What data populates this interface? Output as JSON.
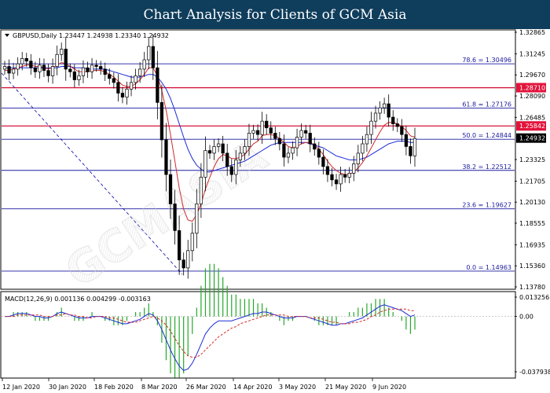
{
  "header": {
    "title": "Chart Analysis for Clients of GCM Asia"
  },
  "chart_data": {
    "type": "candlestick",
    "symbol_info": "GBPUSD,Daily  1.23447 1.24938 1.23340 1.24932",
    "y_ticks": [
      "1.32865",
      "1.31245",
      "1.29670",
      "1.28090",
      "1.26485",
      "1.24932",
      "1.23325",
      "1.21705",
      "1.20130",
      "1.18555",
      "1.16935",
      "1.15360",
      "1.13780"
    ],
    "ylim": [
      1.1378,
      1.32865
    ],
    "x_ticks": [
      "12 Jan 2020",
      "30 Jan 2020",
      "18 Feb 2020",
      "8 Mar 2020",
      "26 Mar 2020",
      "14 Apr 2020",
      "3 May 2020",
      "21 May 2020",
      "9 Jun 2020"
    ],
    "last_price": {
      "label": "1.24932",
      "value": 1.24932
    },
    "fib_levels": [
      {
        "label": "78.6 = 1.30496",
        "value": 1.30496
      },
      {
        "label": "61.8 = 1.27176",
        "value": 1.27176
      },
      {
        "label": "50.0 = 1.24844",
        "value": 1.24844
      },
      {
        "label": "38.2 = 1.22512",
        "value": 1.22512
      },
      {
        "label": "23.6 = 1.19627",
        "value": 1.19627
      },
      {
        "label": "0.0 = 1.14963",
        "value": 1.14963
      }
    ],
    "resistance_levels": [
      {
        "label": "1.28710",
        "value": 1.2871
      },
      {
        "label": "1.25842",
        "value": 1.25842
      }
    ],
    "closes": [
      1.303,
      1.298,
      1.301,
      1.305,
      1.309,
      1.307,
      1.302,
      1.299,
      1.304,
      1.3,
      1.296,
      1.303,
      1.312,
      1.316,
      1.301,
      1.299,
      1.293,
      1.296,
      1.302,
      1.299,
      1.304,
      1.303,
      1.301,
      1.297,
      1.294,
      1.291,
      1.283,
      1.28,
      1.286,
      1.291,
      1.296,
      1.301,
      1.308,
      1.318,
      1.302,
      1.276,
      1.248,
      1.222,
      1.2,
      1.18,
      1.158,
      1.152,
      1.165,
      1.178,
      1.2,
      1.22,
      1.24,
      1.238,
      1.243,
      1.245,
      1.238,
      1.228,
      1.222,
      1.233,
      1.238,
      1.243,
      1.253,
      1.255,
      1.252,
      1.262,
      1.257,
      1.253,
      1.249,
      1.245,
      1.235,
      1.238,
      1.242,
      1.25,
      1.255,
      1.253,
      1.245,
      1.241,
      1.235,
      1.228,
      1.222,
      1.218,
      1.215,
      1.222,
      1.22,
      1.223,
      1.23,
      1.238,
      1.245,
      1.252,
      1.262,
      1.268,
      1.272,
      1.275,
      1.265,
      1.26,
      1.258,
      1.252,
      1.243,
      1.236,
      1.249
    ],
    "ma_red": [
      1.3,
      1.3,
      1.301,
      1.302,
      1.303,
      1.304,
      1.304,
      1.303,
      1.303,
      1.302,
      1.301,
      1.302,
      1.304,
      1.306,
      1.305,
      1.303,
      1.301,
      1.299,
      1.299,
      1.299,
      1.3,
      1.3,
      1.3,
      1.299,
      1.297,
      1.295,
      1.292,
      1.289,
      1.288,
      1.288,
      1.29,
      1.293,
      1.297,
      1.302,
      1.302,
      1.296,
      1.285,
      1.27,
      1.252,
      1.232,
      1.212,
      1.196,
      1.188,
      1.187,
      1.192,
      1.2,
      1.211,
      1.22,
      1.228,
      1.234,
      1.237,
      1.236,
      1.234,
      1.234,
      1.235,
      1.237,
      1.241,
      1.245,
      1.247,
      1.251,
      1.252,
      1.252,
      1.251,
      1.249,
      1.246,
      1.243,
      1.242,
      1.243,
      1.245,
      1.246,
      1.246,
      1.244,
      1.241,
      1.237,
      1.232,
      1.228,
      1.225,
      1.223,
      1.222,
      1.222,
      1.224,
      1.227,
      1.231,
      1.236,
      1.242,
      1.248,
      1.254,
      1.259,
      1.261,
      1.261,
      1.26,
      1.258,
      1.255,
      1.251,
      1.25
    ],
    "ma_blue": [
      1.302,
      1.302,
      1.302,
      1.302,
      1.302,
      1.302,
      1.302,
      1.302,
      1.302,
      1.302,
      1.302,
      1.302,
      1.302,
      1.303,
      1.303,
      1.303,
      1.302,
      1.302,
      1.302,
      1.301,
      1.301,
      1.301,
      1.301,
      1.301,
      1.3,
      1.299,
      1.298,
      1.297,
      1.296,
      1.295,
      1.295,
      1.295,
      1.296,
      1.297,
      1.297,
      1.295,
      1.291,
      1.286,
      1.279,
      1.27,
      1.26,
      1.25,
      1.241,
      1.234,
      1.229,
      1.226,
      1.224,
      1.224,
      1.225,
      1.226,
      1.227,
      1.228,
      1.229,
      1.23,
      1.231,
      1.232,
      1.234,
      1.236,
      1.238,
      1.24,
      1.242,
      1.244,
      1.245,
      1.246,
      1.246,
      1.246,
      1.246,
      1.246,
      1.246,
      1.246,
      1.245,
      1.244,
      1.243,
      1.242,
      1.24,
      1.238,
      1.236,
      1.235,
      1.234,
      1.233,
      1.233,
      1.233,
      1.234,
      1.235,
      1.237,
      1.239,
      1.241,
      1.243,
      1.245,
      1.246,
      1.247,
      1.247,
      1.247,
      1.246,
      1.246
    ],
    "macd": {
      "label": "MACD(12,26,9) 0.001136 0.004299 -0.003163",
      "y_ticks": [
        "0.013256",
        "0.00",
        "-0.037938"
      ],
      "ylim": [
        -0.037938,
        0.013256
      ],
      "line": [
        0.0,
        0.0,
        0.001,
        0.002,
        0.002,
        0.002,
        0.001,
        0.0,
        0.0,
        -0.001,
        -0.001,
        0.0,
        0.002,
        0.003,
        0.002,
        0.001,
        0.0,
        -0.001,
        -0.001,
        -0.001,
        0.0,
        0.0,
        0.0,
        -0.001,
        -0.002,
        -0.003,
        -0.004,
        -0.005,
        -0.005,
        -0.004,
        -0.003,
        -0.002,
        0.0,
        0.002,
        0.001,
        -0.003,
        -0.009,
        -0.016,
        -0.023,
        -0.029,
        -0.034,
        -0.037,
        -0.036,
        -0.032,
        -0.026,
        -0.019,
        -0.012,
        -0.008,
        -0.005,
        -0.003,
        -0.003,
        -0.003,
        -0.003,
        -0.002,
        -0.001,
        0.0,
        0.001,
        0.002,
        0.002,
        0.003,
        0.003,
        0.002,
        0.001,
        0.0,
        -0.001,
        -0.001,
        -0.001,
        0.0,
        0.0,
        0.0,
        -0.001,
        -0.002,
        -0.003,
        -0.004,
        -0.005,
        -0.006,
        -0.006,
        -0.005,
        -0.005,
        -0.004,
        -0.003,
        -0.002,
        -0.001,
        0.001,
        0.003,
        0.005,
        0.007,
        0.008,
        0.007,
        0.006,
        0.005,
        0.004,
        0.002,
        0.0,
        0.001
      ],
      "signal": [
        0.0,
        0.0,
        0.0,
        0.001,
        0.001,
        0.001,
        0.001,
        0.001,
        0.001,
        0.0,
        0.0,
        0.0,
        0.001,
        0.001,
        0.002,
        0.001,
        0.001,
        0.0,
        0.0,
        -0.001,
        -0.001,
        0.0,
        0.0,
        0.0,
        -0.001,
        -0.001,
        -0.002,
        -0.003,
        -0.004,
        -0.004,
        -0.004,
        -0.003,
        -0.002,
        -0.001,
        0.0,
        -0.001,
        -0.003,
        -0.006,
        -0.01,
        -0.015,
        -0.02,
        -0.024,
        -0.027,
        -0.028,
        -0.028,
        -0.026,
        -0.023,
        -0.02,
        -0.017,
        -0.014,
        -0.012,
        -0.01,
        -0.008,
        -0.007,
        -0.005,
        -0.004,
        -0.003,
        -0.002,
        -0.001,
        0.0,
        0.001,
        0.001,
        0.001,
        0.001,
        0.001,
        0.0,
        0.0,
        0.0,
        0.0,
        0.0,
        -0.001,
        -0.001,
        -0.001,
        -0.002,
        -0.003,
        -0.004,
        -0.004,
        -0.005,
        -0.005,
        -0.005,
        -0.004,
        -0.004,
        -0.003,
        -0.002,
        0.0,
        0.001,
        0.003,
        0.004,
        0.005,
        0.005,
        0.005,
        0.005,
        0.005,
        0.004,
        0.004
      ]
    }
  }
}
